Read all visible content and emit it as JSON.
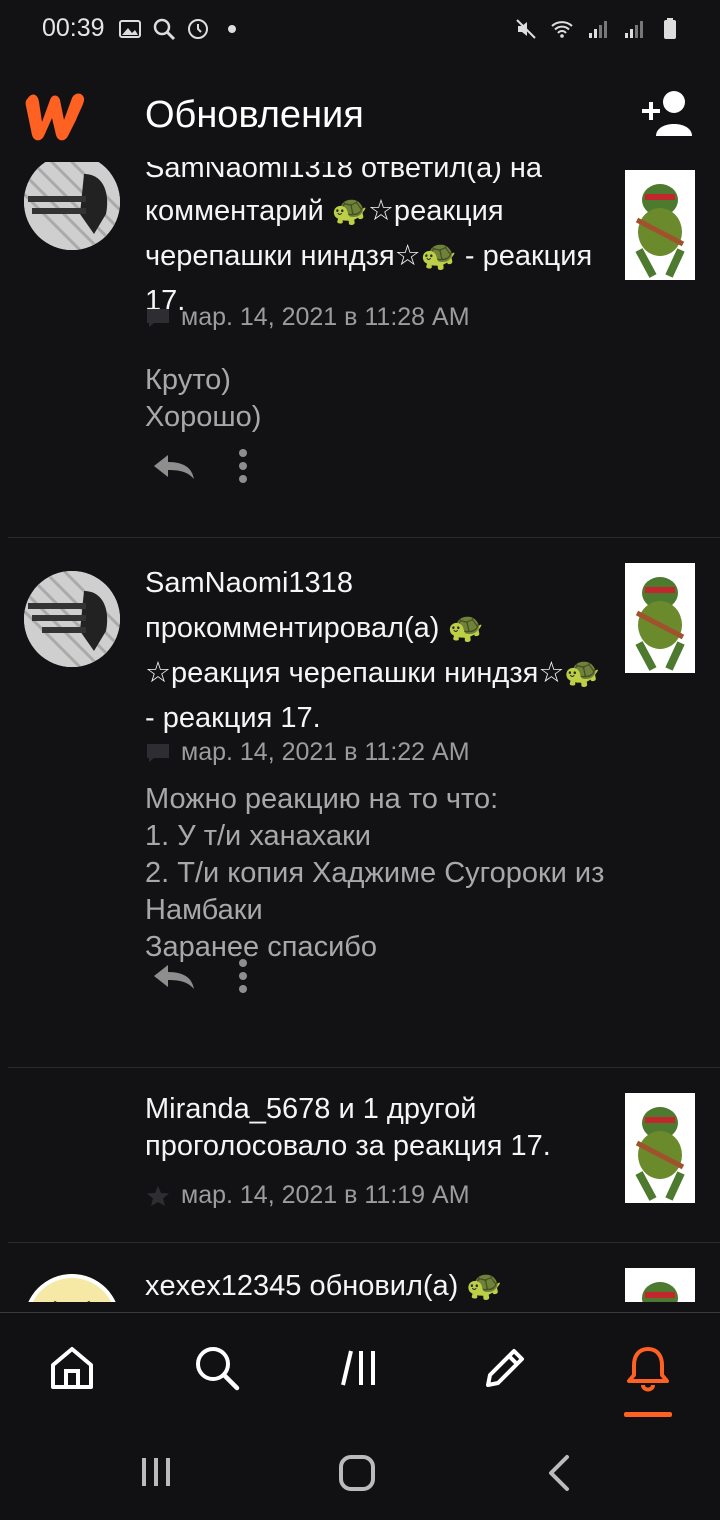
{
  "status_bar": {
    "time": "00:39",
    "left_icons": [
      "image-icon",
      "search-icon",
      "clock-icon",
      "dot-icon"
    ],
    "right_icons": [
      "mute-icon",
      "wifi-icon",
      "signal-icon",
      "signal-icon",
      "battery-icon"
    ]
  },
  "header": {
    "title": "Обновления",
    "logo": "wattpad-logo",
    "action_icon": "add-user-icon"
  },
  "feed": {
    "items": [
      {
        "text_partial": "SamNaomi1318 ответил(а) на",
        "text": "комментарий 🐢☆реакция черепашки ниндзя☆🐢 - реакция 17.",
        "meta_icon": "comment-icon",
        "date": "мар. 14, 2021 в 11:28 AM",
        "body": "Круто)\nХорошо)"
      },
      {
        "text": "SamNaomi1318 прокомментировал(а) 🐢 ☆реакция черепашки ниндзя☆🐢 - реакция 17.",
        "meta_icon": "comment-icon",
        "date": "мар. 14, 2021 в 11:22 AM",
        "body": "Можно реакцию на то что:\n1. У т/и ханахаки\n2. Т/и копия Хаджиме Сугороки из Намбаки\nЗаранее спасибо"
      },
      {
        "text": "Miranda_5678 и 1 другой проголосовало за реакция 17.",
        "meta_icon": "star-icon",
        "date": "мар. 14, 2021 в 11:19 AM"
      },
      {
        "text": "xexex12345 обновил(а) 🐢"
      }
    ]
  },
  "bottom_nav": {
    "items": [
      "home-icon",
      "search-icon",
      "library-icon",
      "write-icon",
      "notifications-icon"
    ],
    "active": "notifications-icon",
    "accent": "#ff6122"
  },
  "system_nav": [
    "recents-icon",
    "home-icon",
    "back-icon"
  ]
}
